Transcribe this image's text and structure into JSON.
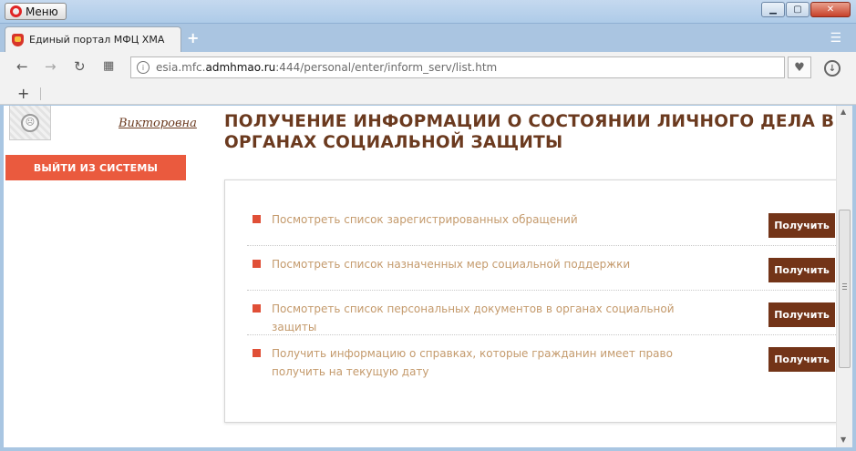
{
  "window": {
    "menu_label": "Меню",
    "controls": {
      "minimize": "▁",
      "maximize": "▢",
      "close": "✕"
    }
  },
  "tabs": {
    "active_title": "Единый портал МФЦ ХМА",
    "new_tab_label": "+",
    "tab_menu_icon": "☰"
  },
  "toolbar": {
    "url_prefix": "esia.mfc.",
    "url_domain": "admhmao.ru",
    "url_suffix": ":444/personal/enter/inform_serv/list.htm",
    "back_icon": "←",
    "forward_icon": "→",
    "reload_icon": "↻",
    "speed_dial_icon": "▦",
    "site_info_icon": "i",
    "bookmark_icon": "♥",
    "download_icon": "↓"
  },
  "bookmarks": {
    "add_label": "+"
  },
  "sidebar": {
    "user_name": "Викторовна",
    "logout_label": "ВЫЙТИ ИЗ СИСТЕМЫ"
  },
  "main": {
    "title": "ПОЛУЧЕНИЕ ИНФОРМАЦИИ О СОСТОЯНИИ ЛИЧНОГО ДЕЛА В ОРГАНАХ СОЦИАЛЬНОЙ ЗАЩИТЫ",
    "services": [
      {
        "text": "Посмотреть список зарегистрированных обращений",
        "button": "Получить"
      },
      {
        "text": "Посмотреть список назначенных мер социальной поддержки",
        "button": "Получить"
      },
      {
        "text": "Посмотреть список персональных документов в органах социальной защиты",
        "button": "Получить"
      },
      {
        "text": "Получить информацию о справках, которые гражданин имеет право получить на текущую дату",
        "button": "Получить"
      }
    ]
  },
  "colors": {
    "brand_brown": "#6b3a1f",
    "button_brown": "#733418",
    "logout_red": "#ea5a3e",
    "bullet_red": "#e04f37",
    "service_text": "#c49a6c"
  }
}
